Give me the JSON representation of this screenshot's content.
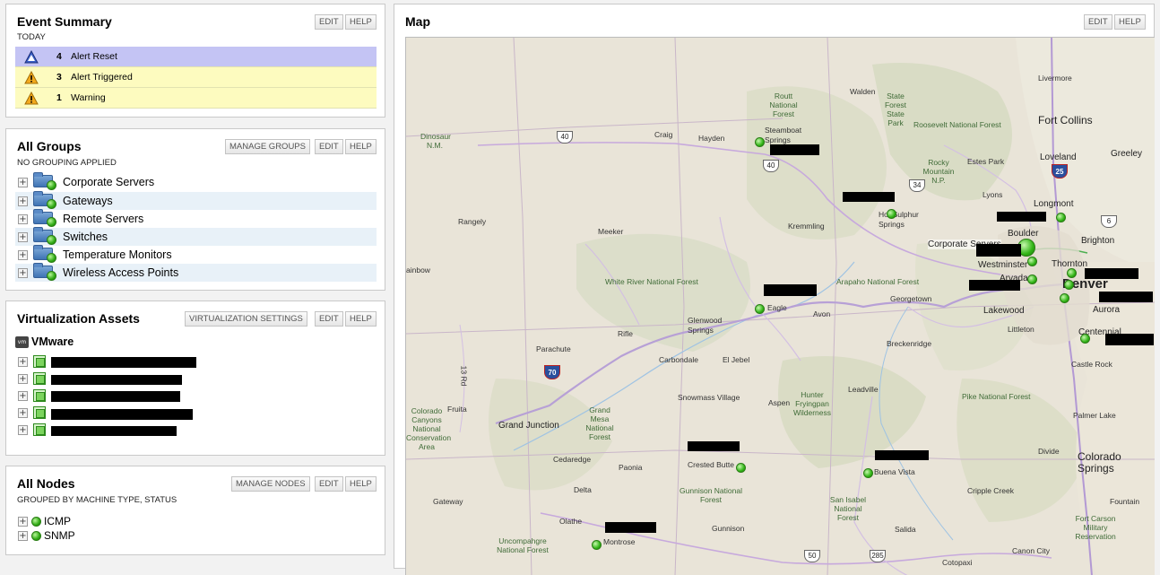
{
  "event_summary": {
    "title": "Event Summary",
    "subtitle": "TODAY",
    "edit_label": "EDIT",
    "help_label": "HELP",
    "rows": [
      {
        "count": "4",
        "label": "Alert Reset",
        "color": "#c4c4f4"
      },
      {
        "count": "3",
        "label": "Alert Triggered",
        "color": "#fdfbbf"
      },
      {
        "count": "1",
        "label": "Warning",
        "color": "#fdfbbf"
      }
    ]
  },
  "all_groups": {
    "title": "All Groups",
    "subtitle": "NO GROUPING APPLIED",
    "manage_label": "MANAGE GROUPS",
    "edit_label": "EDIT",
    "help_label": "HELP",
    "items": [
      {
        "label": "Corporate Servers"
      },
      {
        "label": "Gateways"
      },
      {
        "label": "Remote Servers"
      },
      {
        "label": "Switches"
      },
      {
        "label": "Temperature Monitors"
      },
      {
        "label": "Wireless Access Points"
      }
    ]
  },
  "virtualization": {
    "title": "Virtualization Assets",
    "settings_label": "VIRTUALIZATION SETTINGS",
    "edit_label": "EDIT",
    "help_label": "HELP",
    "vmware_label": "VMware"
  },
  "all_nodes": {
    "title": "All Nodes",
    "subtitle": "GROUPED BY MACHINE TYPE, STATUS",
    "manage_label": "MANAGE NODES",
    "edit_label": "EDIT",
    "help_label": "HELP",
    "items": [
      {
        "label": "ICMP"
      },
      {
        "label": "SNMP"
      }
    ]
  },
  "map": {
    "title": "Map",
    "edit_label": "EDIT",
    "help_label": "HELP",
    "labels": {
      "livermore": "Livermore",
      "walden": "Walden",
      "routt": "Routt National Forest",
      "steamboat": "Steamboat Springs",
      "state_forest": "State Forest State Park",
      "roosevelt": "Roosevelt National Forest",
      "fort_collins": "Fort Collins",
      "dinosaur": "Dinosaur N.M.",
      "craig": "Craig",
      "hayden": "Hayden",
      "loveland": "Loveland",
      "greeley": "Greeley",
      "estes": "Estes Park",
      "rmnp": "Rocky Mountain N.P.",
      "lyons": "Lyons",
      "longmont": "Longmont",
      "rangely": "Rangely",
      "meeker": "Meeker",
      "kremmling": "Kremmling",
      "hot_sulphur": "Hot Sulphur Springs",
      "boulder": "Boulder",
      "brighton": "Brighton",
      "corporate_servers": "Corporate Servers",
      "westminster": "Westminster",
      "thornton": "Thornton",
      "rainbow": "ainbow",
      "white_river": "White River National Forest",
      "arapaho": "Arapaho National Forest",
      "arvada": "Arvada",
      "denver": "Denver",
      "georgetown": "Georgetown",
      "eagle": "Eagle",
      "avon": "Avon",
      "glenwood": "Glenwood Springs",
      "lakewood": "Lakewood",
      "aurora": "Aurora",
      "littleton": "Littleton",
      "centennial": "Centennial",
      "parachute": "Parachute",
      "rifle": "Rifle",
      "breckenridge": "Breckenridge",
      "carbondale": "Carbondale",
      "el_jebel": "El Jebel",
      "castle_rock": "Castle Rock",
      "leadville": "Leadville",
      "snowmass": "Snowmass Village",
      "aspen": "Aspen",
      "hunter": "Hunter Fryingpan Wilderness",
      "pike": "Pike National Forest",
      "colorado_canyons": "Colorado Canyons National Conservation Area",
      "fruita": "Fruita",
      "grand_junction": "Grand Junction",
      "grand_mesa": "Grand Mesa National Forest",
      "palmer_lake": "Palmer Lake",
      "divide": "Divide",
      "cedaredge": "Cedaredge",
      "paonia": "Paonia",
      "crested_butte": "Crested Butte",
      "buena_vista": "Buena Vista",
      "colorado_springs": "Colorado Springs",
      "delta": "Delta",
      "gunnison_nf": "Gunnison National Forest",
      "cripple_creek": "Cripple Creek",
      "gateway": "Gateway",
      "san_isabel": "San Isabel National Forest",
      "fountain": "Fountain",
      "olathe": "Olathe",
      "gunnison": "Gunnison",
      "salida": "Salida",
      "fort_carson": "Fort Carson Military Reservation",
      "uncompahgre": "Uncompahgre National Forest",
      "montrose": "Montrose",
      "canon_city": "Canon City",
      "cotopaxi": "Cotopaxi",
      "rd13": "13 Rd"
    },
    "shields": {
      "us40a": "40",
      "us40b": "40",
      "co34": "34",
      "i25": "25",
      "co6": "6",
      "i70": "70",
      "us50": "50",
      "us285": "285"
    }
  }
}
